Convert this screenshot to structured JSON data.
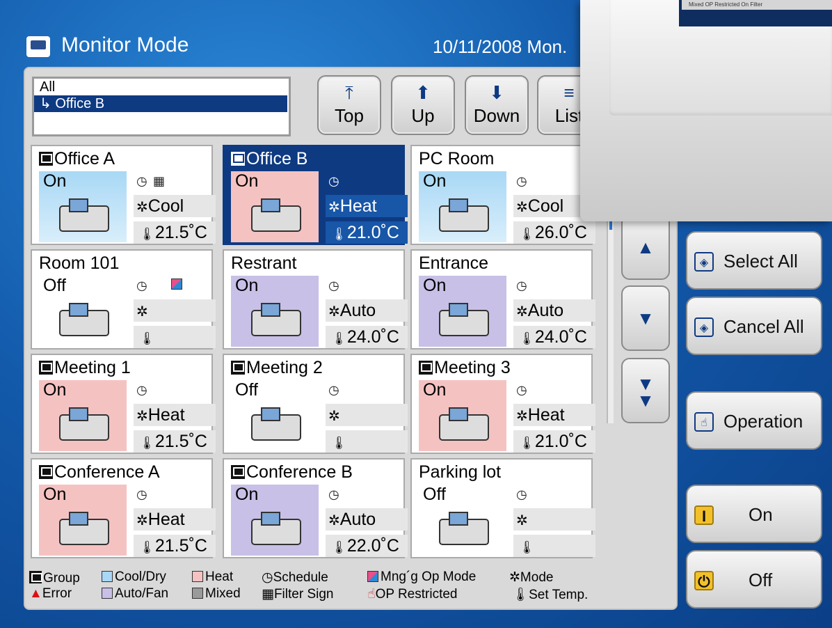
{
  "header": {
    "title": "Monitor Mode",
    "date": "10/11/2008 Mon."
  },
  "tree": {
    "root": "All",
    "selected": "↳ Office B"
  },
  "nav_buttons": [
    {
      "label": "Top",
      "icon": "⤒"
    },
    {
      "label": "Up",
      "icon": "⬆"
    },
    {
      "label": "Down",
      "icon": "⬇"
    },
    {
      "label": "List",
      "icon": "≡"
    }
  ],
  "cells": [
    {
      "name": "Office A",
      "group": true,
      "status": "On",
      "mode": "Cool",
      "temp": "21.5˚C",
      "color": "cool",
      "filter": true
    },
    {
      "name": "Office B",
      "group": true,
      "status": "On",
      "mode": "Heat",
      "temp": "21.0˚C",
      "color": "heat",
      "selected": true
    },
    {
      "name": "PC Room",
      "group": false,
      "status": "On",
      "mode": "Cool",
      "temp": "26.0˚C",
      "color": "cool"
    },
    {
      "name": "Room 101",
      "group": false,
      "status": "Off",
      "mode": "",
      "temp": "",
      "color": "off",
      "managed": true
    },
    {
      "name": "Restrant",
      "group": false,
      "status": "On",
      "mode": "Auto",
      "temp": "24.0˚C",
      "color": "auto"
    },
    {
      "name": "Entrance",
      "group": false,
      "status": "On",
      "mode": "Auto",
      "temp": "24.0˚C",
      "color": "auto"
    },
    {
      "name": "Meeting 1",
      "group": true,
      "status": "On",
      "mode": "Heat",
      "temp": "21.5˚C",
      "color": "heat"
    },
    {
      "name": "Meeting 2",
      "group": true,
      "status": "Off",
      "mode": "",
      "temp": "",
      "color": "off"
    },
    {
      "name": "Meeting 3",
      "group": true,
      "status": "On",
      "mode": "Heat",
      "temp": "21.0˚C",
      "color": "heat"
    },
    {
      "name": "Conference A",
      "group": true,
      "status": "On",
      "mode": "Heat",
      "temp": "21.5˚C",
      "color": "heat"
    },
    {
      "name": "Conference B",
      "group": true,
      "status": "On",
      "mode": "Auto",
      "temp": "22.0˚C",
      "color": "auto"
    },
    {
      "name": "Parking lot",
      "group": false,
      "status": "Off",
      "mode": "",
      "temp": "",
      "color": "off"
    }
  ],
  "right_buttons": {
    "select_all": "Select All",
    "cancel_all": "Cancel All",
    "operation": "Operation",
    "on": "On",
    "off": "Off"
  },
  "legend": {
    "group": "Group",
    "error": "Error",
    "cool_dry": "Cool/Dry",
    "auto_fan": "Auto/Fan",
    "heat": "Heat",
    "mixed": "Mixed",
    "schedule": "Schedule",
    "filter_sign": "Filter Sign",
    "mng_op_mode": "Mng´g Op Mode",
    "op_restricted": "OP Restricted",
    "mode": "Mode",
    "set_temp": "Set Temp."
  },
  "bezel": {
    "strip_text": "Mixed   OP Restricted   On   Filter"
  },
  "colors": {
    "cool": "#a8d8f5",
    "heat": "#f5c2c2",
    "auto": "#c8c0e6",
    "mixed": "#9a9a9a",
    "selected": "#0e3a82",
    "accent_blue": "#135aab"
  }
}
